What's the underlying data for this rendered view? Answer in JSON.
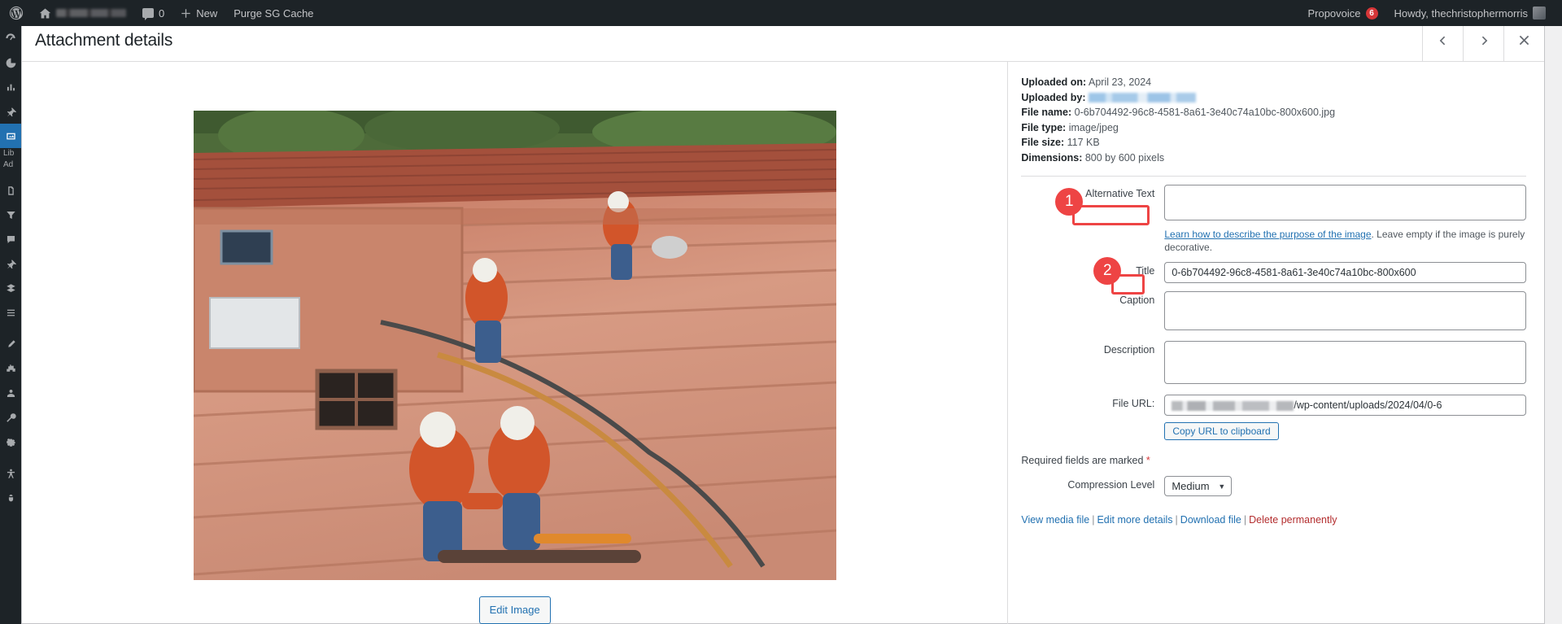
{
  "adminbar": {
    "wp_logo_icon": "wordpress-logo-icon",
    "home_icon": "home-icon",
    "site_name_redacted": "",
    "comments_icon": "comment-bubble-icon",
    "comments_count": "0",
    "new_icon": "plus-icon",
    "new_label": "New",
    "purge_label": "Purge SG Cache",
    "right_plugin_label": "Propovoice",
    "right_plugin_badge": "6",
    "howdy_label": "Howdy, thechristophermorris",
    "avatar_icon": "user-avatar"
  },
  "adminmenu": {
    "items": [
      {
        "icon": "dashboard-icon",
        "label": ""
      },
      {
        "icon": "analytics-icon",
        "label": ""
      },
      {
        "icon": "chart-icon",
        "label": ""
      },
      {
        "icon": "pin-icon",
        "label": ""
      },
      {
        "icon": "media-icon",
        "label": "",
        "current": true
      },
      {
        "icon": "library-label",
        "label": "Lib"
      },
      {
        "icon": "add-label",
        "label": "Ad"
      },
      {
        "icon": "pages-icon",
        "label": ""
      },
      {
        "icon": "filter-icon",
        "label": ""
      },
      {
        "icon": "comments-icon",
        "label": ""
      },
      {
        "icon": "pin2-icon",
        "label": ""
      },
      {
        "icon": "layers-icon",
        "label": ""
      },
      {
        "icon": "list-icon",
        "label": ""
      },
      {
        "icon": "appearance-icon",
        "label": ""
      },
      {
        "icon": "plugins-icon",
        "label": ""
      },
      {
        "icon": "users-icon",
        "label": ""
      },
      {
        "icon": "tools-icon",
        "label": ""
      },
      {
        "icon": "settings-icon",
        "label": ""
      },
      {
        "icon": "accessibility-icon",
        "label": ""
      },
      {
        "icon": "bug-icon",
        "label": ""
      }
    ]
  },
  "modal": {
    "title": "Attachment details",
    "prev_icon": "chevron-left-icon",
    "next_icon": "chevron-right-icon",
    "close_icon": "close-icon",
    "edit_image_label": "Edit Image"
  },
  "meta": {
    "uploaded_on_label": "Uploaded on:",
    "uploaded_on_value": "April 23, 2024",
    "uploaded_by_label": "Uploaded by:",
    "uploaded_by_value": "",
    "file_name_label": "File name:",
    "file_name_value": "0-6b704492-96c8-4581-8a61-3e40c74a10bc-800x600.jpg",
    "file_type_label": "File type:",
    "file_type_value": "image/jpeg",
    "file_size_label": "File size:",
    "file_size_value": "117 KB",
    "dimensions_label": "Dimensions:",
    "dimensions_value": "800 by 600 pixels"
  },
  "fields": {
    "alt_label": "Alternative Text",
    "alt_value": "",
    "alt_help_link": "Learn how to describe the purpose of the image",
    "alt_help_rest": ". Leave empty if the image is purely decorative.",
    "title_label": "Title",
    "title_value": "0-6b704492-96c8-4581-8a61-3e40c74a10bc-800x600",
    "caption_label": "Caption",
    "caption_value": "",
    "description_label": "Description",
    "description_value": "",
    "file_url_label": "File URL:",
    "file_url_value_suffix": "/wp-content/uploads/2024/04/0-6",
    "copy_url_label": "Copy URL to clipboard"
  },
  "footer": {
    "required_note": "Required fields are marked",
    "required_star": "*",
    "compression_label": "Compression Level",
    "compression_value": "Medium",
    "compression_options": [
      "Medium"
    ],
    "view_media_file": "View media file",
    "edit_more_details": "Edit more details",
    "download_file": "Download file",
    "delete_permanently": "Delete permanently"
  },
  "annotations": [
    {
      "number": "1",
      "target": "alt-text-label"
    },
    {
      "number": "2",
      "target": "title-label"
    }
  ],
  "colors": {
    "annotation_red": "#ee4444",
    "wp_blue": "#2271b1",
    "adminbar_bg": "#1d2327",
    "danger_red": "#b32d2e"
  }
}
